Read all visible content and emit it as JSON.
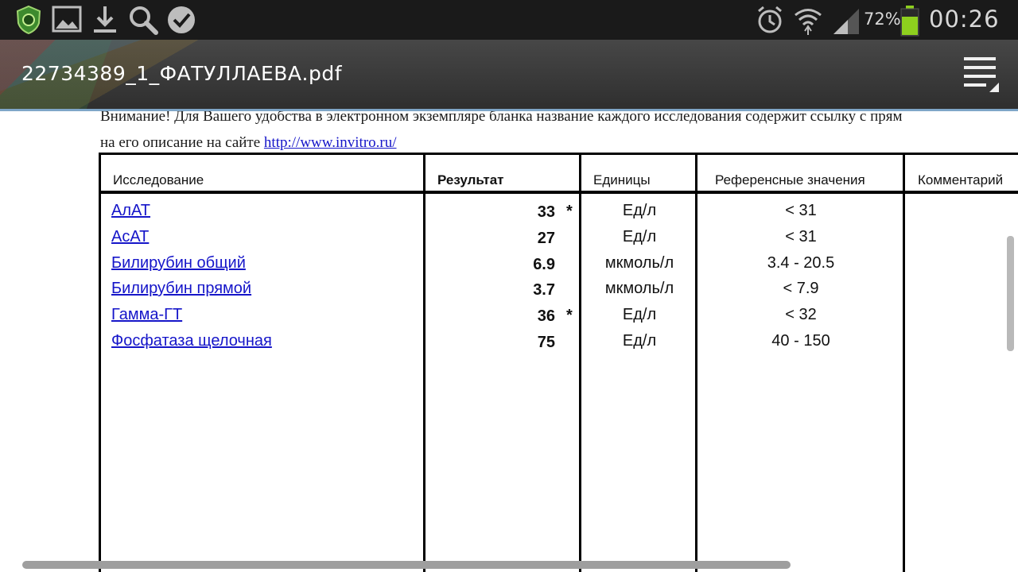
{
  "status_bar": {
    "battery_percent": "72%",
    "time": "00:26",
    "icons": [
      "antivirus-icon",
      "image-icon",
      "download-icon",
      "search-icon",
      "check-icon",
      "alarm-icon",
      "wifi-icon",
      "signal-icon",
      "battery-icon"
    ]
  },
  "action_bar": {
    "title": "22734389_1_ФАТУЛЛАЕВА.pdf",
    "menu_icon": "menu-icon"
  },
  "document": {
    "notice_line1": "Внимание! Для Вашего удобства в электронном экземпляре бланка название каждого исследования содержит ссылку с прям",
    "notice_line2_prefix": "на его описание на сайте ",
    "notice_link": "http://www.invitro.ru/",
    "table": {
      "headers": {
        "test": "Исследование",
        "result": "Результат",
        "units": "Единицы",
        "reference": "Референсные значения",
        "comment": "Комментарий"
      },
      "rows": [
        {
          "name": "АлАТ",
          "value": "33",
          "flag": "*",
          "unit": "Ед/л",
          "ref": "< 31"
        },
        {
          "name": "АсАТ",
          "value": "27",
          "flag": "",
          "unit": "Ед/л",
          "ref": "< 31"
        },
        {
          "name": "Билирубин общий",
          "value": "6.9",
          "flag": "",
          "unit": "мкмоль/л",
          "ref": "3.4 - 20.5"
        },
        {
          "name": "Билирубин прямой",
          "value": "3.7",
          "flag": "",
          "unit": "мкмоль/л",
          "ref": "< 7.9"
        },
        {
          "name": "Гамма-ГТ",
          "value": "36",
          "flag": "*",
          "unit": "Ед/л",
          "ref": "< 32"
        },
        {
          "name": "Фосфатаза щелочная",
          "value": "75",
          "flag": "",
          "unit": "Ед/л",
          "ref": "40 - 150"
        }
      ]
    }
  },
  "colors": {
    "status_bar_bg": "#1a1a1a",
    "action_bar_bg": "#3a3a3a",
    "link": "#1515c9",
    "battery": "#8ed01e"
  }
}
